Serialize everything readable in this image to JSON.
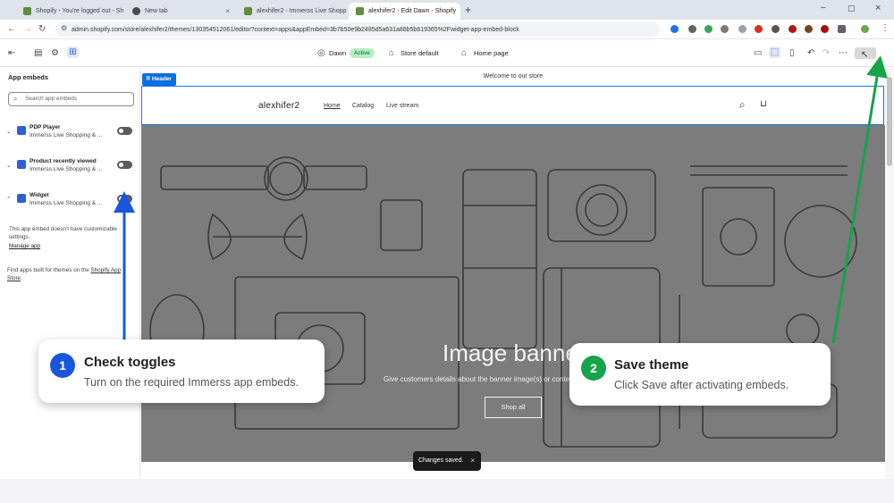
{
  "browser": {
    "tabs": [
      {
        "title": "Shopify - You're logged out - Sh",
        "active": false,
        "color": "#5e8e3e"
      },
      {
        "title": "New tab",
        "active": false,
        "color": "#4a4a4a"
      },
      {
        "title": "alexhifer2 - Immerss Live Shopp",
        "active": false,
        "color": "#5e8e3e"
      },
      {
        "title": "alexhifer2 - Edit Dawn - Shopify",
        "active": true,
        "color": "#5e8e3e"
      }
    ],
    "new_tab": "+",
    "url": "admin.shopify.com/store/alexhifer2/themes/130354512061/editor?context=apps&appEmbed=3b7b50e9b2485d5a631a88b5b619365%2Fwidget-app-embed-block"
  },
  "toolbar": {
    "theme_name": "Dawn",
    "theme_status": "Active",
    "store_setting": "Store default",
    "page": "Home page"
  },
  "sidebar": {
    "title": "App embeds",
    "search_placeholder": "Search app embeds",
    "embeds": [
      {
        "name": "PDP Player",
        "subtitle": "Immerss Live Shopping & ..."
      },
      {
        "name": "Product recently viewed",
        "subtitle": "Immerss Live Shopping & ..."
      },
      {
        "name": "Widget",
        "subtitle": "Immerss Live Shopping & ..."
      }
    ],
    "no_settings_line1": "This app embed doesn't have customizable",
    "no_settings_line2": "settings.",
    "manage_app": "Manage app",
    "find_apps_line1": "Find apps built for themes on the ",
    "find_apps_link1": "Shopify App",
    "find_apps_link2": "Store",
    "find_apps_end": "."
  },
  "preview": {
    "announcement": "Welcome to our store",
    "header_tag": "Header",
    "store_name": "alexhifer2",
    "nav": [
      "Home",
      "Catalog",
      "Live stream"
    ],
    "banner_title": "Image banner",
    "banner_subtitle": "Give customers details about the banner image(s) or content on the template.",
    "banner_button": "Shop all"
  },
  "toast": {
    "text": "Changes saved.",
    "close": "×"
  },
  "callouts": [
    {
      "number": "1",
      "title": "Check toggles",
      "description": "Turn on the required Immerss app embeds.",
      "color": "#1a56db"
    },
    {
      "number": "2",
      "title": "Save theme",
      "description": "Click Save after activating embeds.",
      "color": "#16a34a"
    }
  ],
  "arrow_colors": {
    "blue": "#1a56db",
    "green": "#16a34a"
  }
}
